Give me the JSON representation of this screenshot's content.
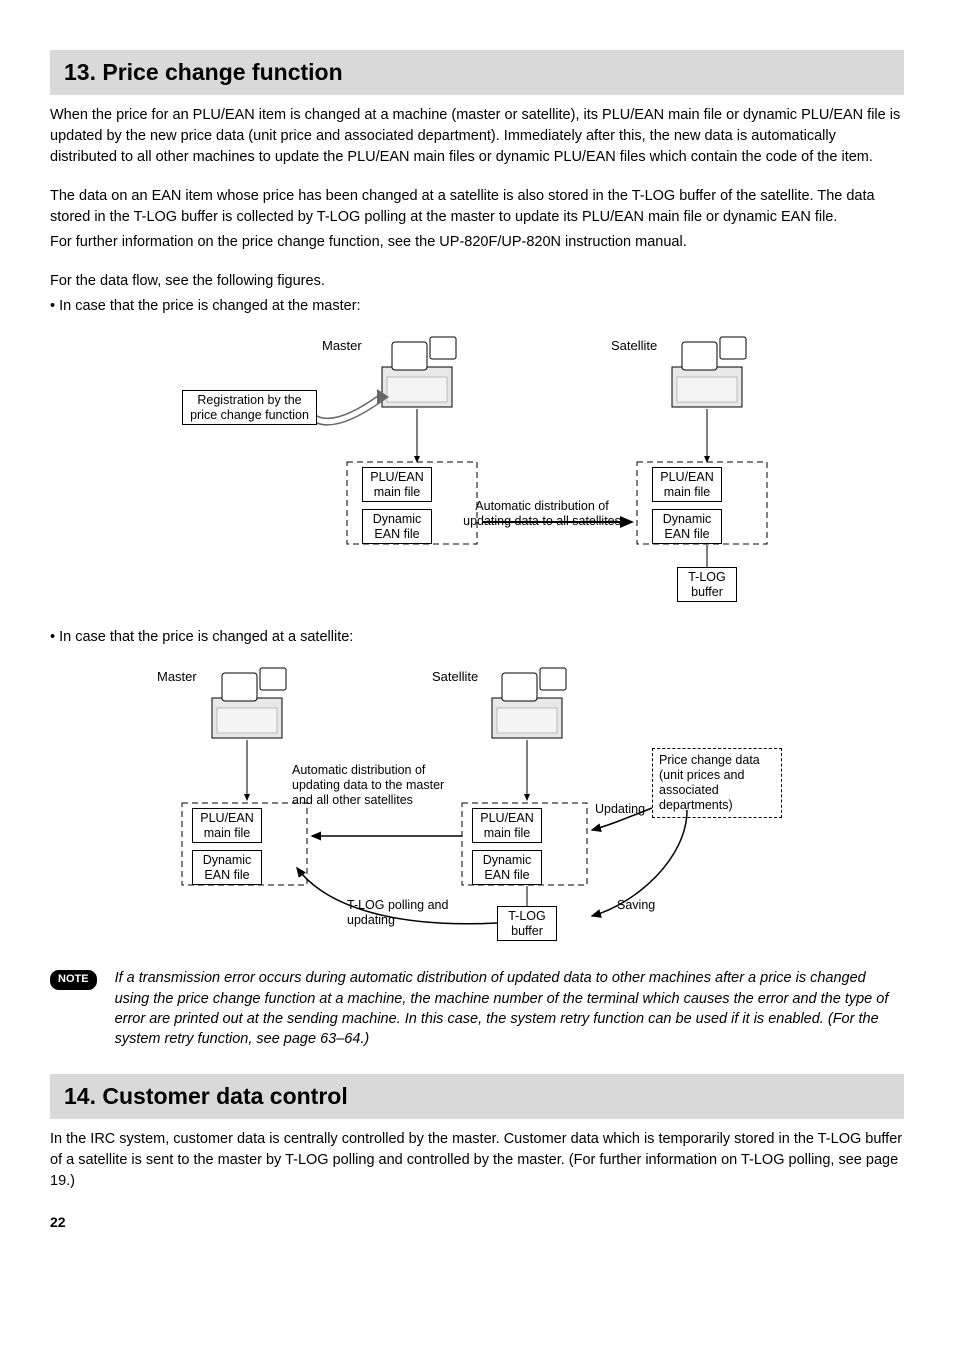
{
  "section13": {
    "heading": "13. Price change function",
    "p1": "When the price for an PLU/EAN item is changed at a machine (master or satellite), its PLU/EAN main file or dynamic PLU/EAN file is updated by the new price data (unit price and associated department). Immediately after this, the new data is automatically distributed to all other machines to update the PLU/EAN main files or dynamic PLU/EAN files which contain the code of the item.",
    "p2": "The data on an EAN item whose price has been changed at a satellite is also stored in the T-LOG buffer of the satellite. The data stored in the T-LOG buffer is collected by T-LOG polling at the master to update its PLU/EAN main file or dynamic EAN file.",
    "p3": "For further information on the price change function, see the UP-820F/UP-820N instruction manual.",
    "p4": "For the data flow, see the following figures.",
    "bullet1": "• In case that the price is changed at the master:",
    "bullet2": "• In case that the price is changed at a satellite:"
  },
  "diag1": {
    "master": "Master",
    "satellite": "Satellite",
    "reg_callout": "Registration by the price change function",
    "plu_main": "PLU/EAN main file",
    "dyn_ean": "Dynamic EAN file",
    "auto_dist": "Automatic distribution of updating data to all satellites",
    "tlog": "T-LOG buffer"
  },
  "diag2": {
    "master": "Master",
    "satellite": "Satellite",
    "plu_main": "PLU/EAN main file",
    "dyn_ean": "Dynamic EAN file",
    "auto_dist": "Automatic distribution of updating data to the master and all other satellites",
    "tlog_poll": "T-LOG polling and updating",
    "tlog": "T-LOG buffer",
    "price_change": "Price change data (unit prices and associated departments)",
    "updating": "Updating",
    "saving": "Saving"
  },
  "note": {
    "label": "NOTE",
    "text": "If a transmission error occurs during automatic distribution of updated data to other machines after a price is changed using the price change function at a machine, the machine number of the terminal which causes the error and the type of error are printed out at the sending machine. In this case, the system retry function can be used if it is enabled. (For the system retry function, see page 63–64.)"
  },
  "section14": {
    "heading": "14. Customer data control",
    "p1": "In the IRC system, customer data is centrally controlled by the master. Customer data which is temporarily stored in the T-LOG buffer of a satellite is sent to the master by T-LOG polling and controlled by the master. (For further information on T-LOG polling, see page 19.)"
  },
  "pageNumber": "22"
}
